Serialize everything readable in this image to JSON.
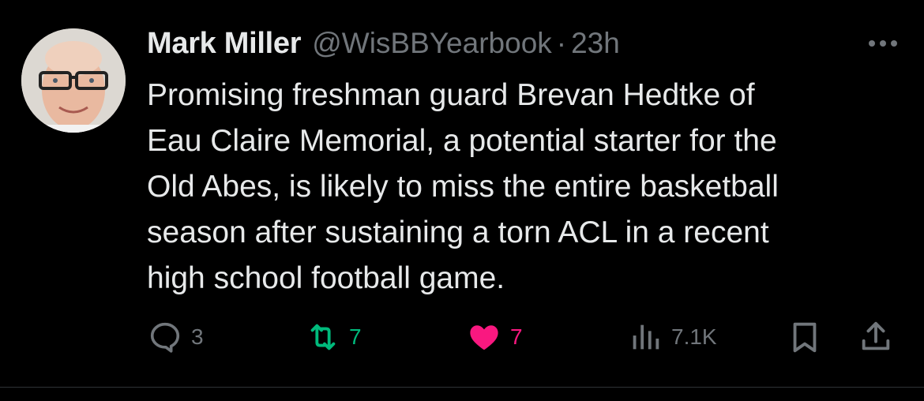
{
  "tweet": {
    "author_name": "Mark Miller",
    "handle": "@WisBBYearbook",
    "separator": "·",
    "time": "23h",
    "text_lines": [
      "Promising freshman guard Brevan Hedtke of",
      "Eau Claire Memorial, a potential starter for the",
      "Old Abes, is likely to miss the entire basketball",
      "season after sustaining a torn ACL in a recent",
      "high school football game."
    ]
  },
  "actions": {
    "replies": "3",
    "retweets": "7",
    "likes": "7",
    "views": "7.1K"
  },
  "icons": {
    "more": "more-dots-icon",
    "reply": "reply-bubble-icon",
    "retweet": "retweet-icon",
    "like": "heart-filled-icon",
    "views": "views-bars-icon",
    "bookmark": "bookmark-icon",
    "share": "share-upload-icon"
  },
  "colors": {
    "background": "#000000",
    "text": "#e7e9ea",
    "muted": "#71767b",
    "retweet": "#00ba7c",
    "like": "#f91880"
  }
}
